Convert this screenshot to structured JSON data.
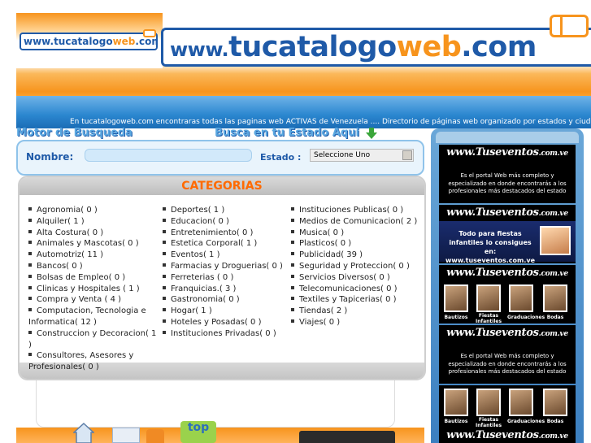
{
  "header": {
    "logo_small_prefix": "www.",
    "logo_small_brand_a": "tucatalogo",
    "logo_small_brand_b": "web",
    "logo_small_suffix": ".com",
    "logo_big_prefix": "www.",
    "logo_big_brand_a": "tucatalogo",
    "logo_big_brand_b": "web",
    "logo_big_suffix": ".com",
    "tagline": "En tucatalogoweb.com encontraras todas las paginas web ACTIVAS de Venezuela .... Directorio de páginas web organizado por estados y ciudades"
  },
  "search": {
    "motor_title": "Motor de Busqueda",
    "busca_title": "Busca en tu Estado Aqui",
    "nombre_label": "Nombre:",
    "nombre_value": "",
    "estado_label": "Estado :",
    "estado_selected": "Seleccione Uno"
  },
  "categories": {
    "title": "CATEGORIAS",
    "col1": [
      "Agronomia( 0 )",
      "Alquiler( 1 )",
      "Alta Costura( 0 )",
      "Animales y Mascotas( 0 )",
      "Automotriz( 11 )",
      "Bancos( 0 )",
      "Bolsas de Empleo( 0 )",
      "Clinicas y Hospitales ( 1 )",
      "Compra y Venta ( 4 )",
      "Computacion, Tecnologia e Informatica( 12 )",
      "Construccion y Decoracion( 1 )",
      "Consultores, Asesores y Profesionales( 0 )"
    ],
    "col2": [
      "Deportes( 1 )",
      "Educacion( 0 )",
      "Entretenimiento( 0 )",
      "Estetica Corporal( 1 )",
      "Eventos( 1 )",
      "Farmacias y Droguerias( 0 )",
      "Ferreterias ( 0 )",
      "Franquicias.( 3 )",
      "Gastronomia( 0 )",
      "Hogar( 1 )",
      "Hoteles y Posadas( 0 )",
      "Instituciones Privadas( 0 )"
    ],
    "col3": [
      "Instituciones Publicas( 0 )",
      "Medios de Comunicacion( 2 )",
      "Musica( 0 )",
      "Plasticos( 0 )",
      "Publicidad( 39 )",
      "Seguridad y Proteccion( 0 )",
      "Servicios Diversos( 0 )",
      "Telecomunicaciones( 0 )",
      "Textiles y Tapicerias( 0 )",
      "Tiendas( 2 )",
      "Viajes( 0 )"
    ]
  },
  "sidebar": {
    "ad_logo_main": "www.Tuseventos",
    "ad_logo_tail": ".com.ve",
    "ad1_text": "Es el portal Web más completo y especializado en donde encontrarás a los profesionales más destacados del estado",
    "ad2_text": "Todo para fiestas infantiles lo consigues en: www.tuseventos.com.ve",
    "ad3_captions": [
      "Bautizos",
      "Fiestas Infantiles",
      "Graduaciones",
      "Bodas"
    ],
    "ad4_text": "Es el portal Web más completo y especializado en donde encontrarás a los profesionales más destacados del estado"
  },
  "footer": {
    "top_label": "top"
  },
  "colors": {
    "brand_blue": "#1f5aa8",
    "brand_orange": "#f7941d",
    "category_title": "#ff6a00"
  }
}
